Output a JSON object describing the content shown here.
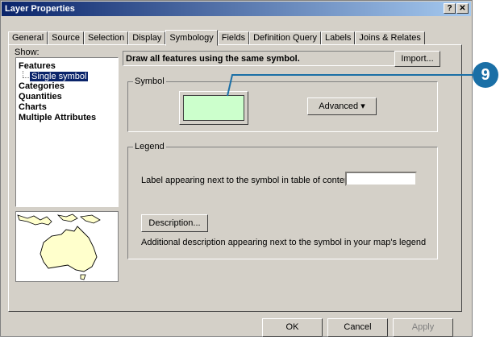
{
  "window": {
    "title": "Layer Properties",
    "help_btn": "?",
    "close_btn": "✕"
  },
  "tabs": [
    "General",
    "Source",
    "Selection",
    "Display",
    "Symbology",
    "Fields",
    "Definition Query",
    "Labels",
    "Joins & Relates"
  ],
  "active_tab": "Symbology",
  "show": {
    "label": "Show:",
    "features": "Features",
    "single_symbol": "Single symbol",
    "categories": "Categories",
    "quantities": "Quantities",
    "charts": "Charts",
    "multiple_attributes": "Multiple Attributes"
  },
  "main": {
    "heading": "Draw all features using the same symbol.",
    "import_btn": "Import..."
  },
  "symbol": {
    "group_label": "Symbol",
    "swatch_color": "#ccffcc",
    "advanced_btn": "Advanced",
    "advanced_arrow": "▾"
  },
  "legend": {
    "group_label": "Legend",
    "label_text": "Label appearing next to the symbol in table of contents:",
    "label_value": "",
    "description_btn": "Description...",
    "description_text": "Additional description appearing next to the symbol in your map's legend"
  },
  "footer": {
    "ok": "OK",
    "cancel": "Cancel",
    "apply": "Apply"
  },
  "callout": {
    "number": "9",
    "color": "#1a6fa6"
  }
}
